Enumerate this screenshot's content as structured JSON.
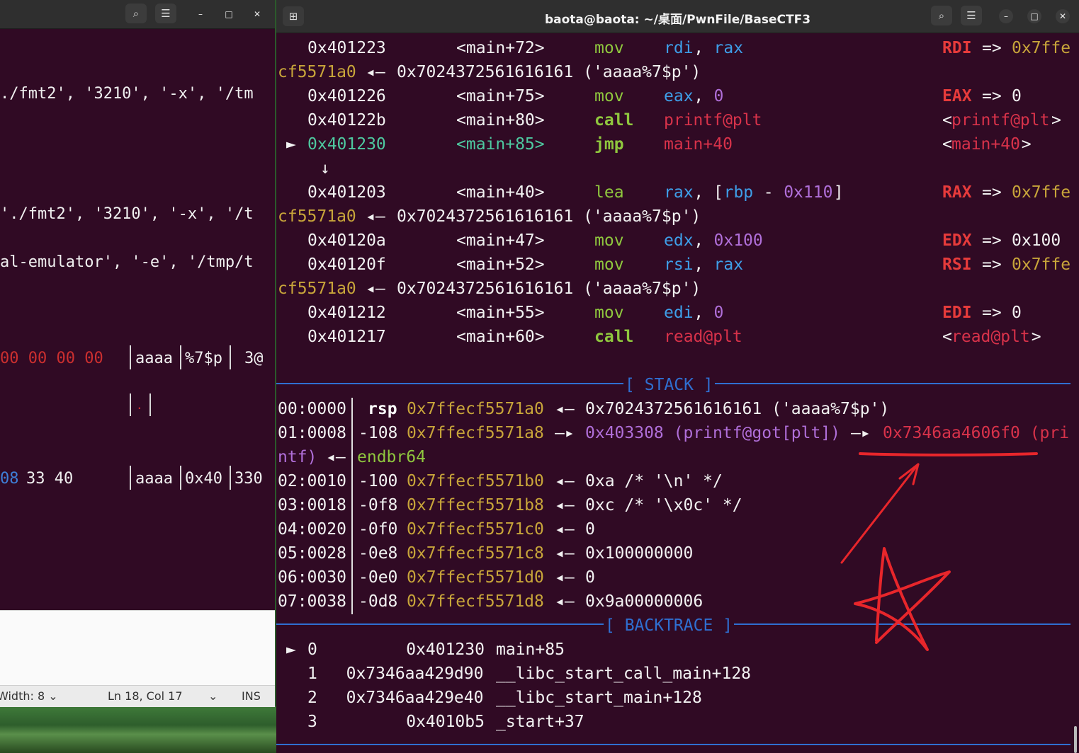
{
  "left_window": {
    "lines": [
      {
        "text": "./fmt2', '3210', '-x', '/tm"
      },
      {
        "text": "'./fmt2', '3210', '-x', '/t"
      },
      {
        "text": "al-emulator', '-e', '/tmp/t"
      }
    ],
    "hex_row1": {
      "hex": "00 00 00 00",
      "ascii": [
        "aaaa",
        "%7$p",
        "3@"
      ]
    },
    "hex_row2": {
      "dot": "."
    },
    "hex_row3": {
      "hex_a": "08",
      "hex_b": "33 40",
      "ascii": [
        "aaaa",
        "0x40",
        "330"
      ]
    },
    "status": {
      "tab_width": "Width: 8",
      "position": "Ln 18, Col 17",
      "mode": "INS"
    }
  },
  "right_window": {
    "title": "baota@baota: ~/桌面/PwnFile/BaseCTF3",
    "disasm": [
      {
        "addr": "0x401223",
        "sym": "<main+72>",
        "op": "mov",
        "args": [
          [
            "rdi",
            "b"
          ],
          [
            ", ",
            "w"
          ],
          [
            "rax",
            "b"
          ]
        ],
        "reg": "RDI",
        "arrow": "=>",
        "val": "0x7ffe",
        "val_cls": "y"
      },
      {
        "wrap": true,
        "addr": "cf5571a0",
        "rest": "0x7024372561616161 ('aaaa%7$p')"
      },
      {
        "addr": "0x401226",
        "sym": "<main+75>",
        "op": "mov",
        "args": [
          [
            "eax",
            "b"
          ],
          [
            ", ",
            "w"
          ],
          [
            "0",
            "p"
          ]
        ],
        "reg": "EAX",
        "arrow": "=>",
        "val": "0",
        "val_cls": "w"
      },
      {
        "addr": "0x40122b",
        "sym": "<main+80>",
        "op": "call",
        "op_bold": true,
        "args": [
          [
            "printf@plt",
            "r"
          ]
        ],
        "target": "printf@plt"
      },
      {
        "current": true,
        "addr": "0x401230",
        "sym": "<main+85>",
        "op": "jmp",
        "op_bold": true,
        "args": [
          [
            "main+40",
            "r"
          ]
        ],
        "target": "main+40"
      },
      {
        "jump_arrow": "↓"
      },
      {
        "addr": "0x401203",
        "sym": "<main+40>",
        "op": "lea",
        "args": [
          [
            "rax",
            "b"
          ],
          [
            ", [",
            "w"
          ],
          [
            "rbp",
            "b"
          ],
          [
            " - ",
            "w"
          ],
          [
            "0x110",
            "p"
          ],
          [
            "]",
            "w"
          ]
        ],
        "reg": "RAX",
        "arrow": "=>",
        "val": "0x7ffe",
        "val_cls": "y"
      },
      {
        "wrap": true,
        "addr": "cf5571a0",
        "rest": "0x7024372561616161 ('aaaa%7$p')"
      },
      {
        "addr": "0x40120a",
        "sym": "<main+47>",
        "op": "mov",
        "args": [
          [
            "edx",
            "b"
          ],
          [
            ", ",
            "w"
          ],
          [
            "0x100",
            "p"
          ]
        ],
        "reg": "EDX",
        "arrow": "=>",
        "val": "0x100",
        "val_cls": "w"
      },
      {
        "addr": "0x40120f",
        "sym": "<main+52>",
        "op": "mov",
        "args": [
          [
            "rsi",
            "b"
          ],
          [
            ", ",
            "w"
          ],
          [
            "rax",
            "b"
          ]
        ],
        "reg": "RSI",
        "arrow": "=>",
        "val": "0x7ffe",
        "val_cls": "y"
      },
      {
        "wrap": true,
        "addr": "cf5571a0",
        "rest": "0x7024372561616161 ('aaaa%7$p')"
      },
      {
        "addr": "0x401212",
        "sym": "<main+55>",
        "op": "mov",
        "args": [
          [
            "edi",
            "b"
          ],
          [
            ", ",
            "w"
          ],
          [
            "0",
            "p"
          ]
        ],
        "reg": "EDI",
        "arrow": "=>",
        "val": "0",
        "val_cls": "w"
      },
      {
        "addr": "0x401217",
        "sym": "<main+60>",
        "op": "call",
        "op_bold": true,
        "args": [
          [
            "read@plt",
            "r"
          ]
        ],
        "target": "read@plt"
      }
    ],
    "stack_label": "[ STACK ]",
    "stack": [
      {
        "idx": "00:0000",
        "reg": "rsp",
        "addr": "0x7ffecf5571a0",
        "arrow": "◂—",
        "val": "0x7024372561616161 ('aaaa%7$p')"
      },
      {
        "idx": "01:0008",
        "reg": "-108",
        "addr": "0x7ffecf5571a8",
        "arrow": "—▸",
        "val": "0x403308 (printf@got[plt])",
        "arrow2": "—▸",
        "val2": "0x7346aa4606f0 (pri"
      },
      {
        "wrap": true,
        "text": "ntf)",
        "arrow": "◂—",
        "val": "endbr64"
      },
      {
        "idx": "02:0010",
        "reg": "-100",
        "addr": "0x7ffecf5571b0",
        "arrow": "◂—",
        "val": "0xa /* '\\n' */"
      },
      {
        "idx": "03:0018",
        "reg": "-0f8",
        "addr": "0x7ffecf5571b8",
        "arrow": "◂—",
        "val": "0xc /* '\\x0c' */"
      },
      {
        "idx": "04:0020",
        "reg": "-0f0",
        "addr": "0x7ffecf5571c0",
        "arrow": "◂—",
        "val": "0"
      },
      {
        "idx": "05:0028",
        "reg": "-0e8",
        "addr": "0x7ffecf5571c8",
        "arrow": "◂—",
        "val": "0x100000000"
      },
      {
        "idx": "06:0030",
        "reg": "-0e0",
        "addr": "0x7ffecf5571d0",
        "arrow": "◂—",
        "val": "0"
      },
      {
        "idx": "07:0038",
        "reg": "-0d8",
        "addr": "0x7ffecf5571d8",
        "arrow": "◂—",
        "val": "0x9a00000006"
      }
    ],
    "backtrace_label": "[ BACKTRACE ]",
    "backtrace": [
      {
        "marker": "►",
        "num": "0",
        "addr": "0x401230",
        "func": "main+85"
      },
      {
        "marker": "",
        "num": "1",
        "addr": "0x7346aa429d90",
        "func": "__libc_start_call_main+128"
      },
      {
        "marker": "",
        "num": "2",
        "addr": "0x7346aa429e40",
        "func": "__libc_start_main+128"
      },
      {
        "marker": "",
        "num": "3",
        "addr": "0x4010b5",
        "func": "_start+37"
      }
    ]
  },
  "colors": {
    "terminal_bg": "#300a24",
    "titlebar_bg": "#2f2f2f",
    "separator": "#2f6fd1",
    "annotation": "#e8262b"
  }
}
